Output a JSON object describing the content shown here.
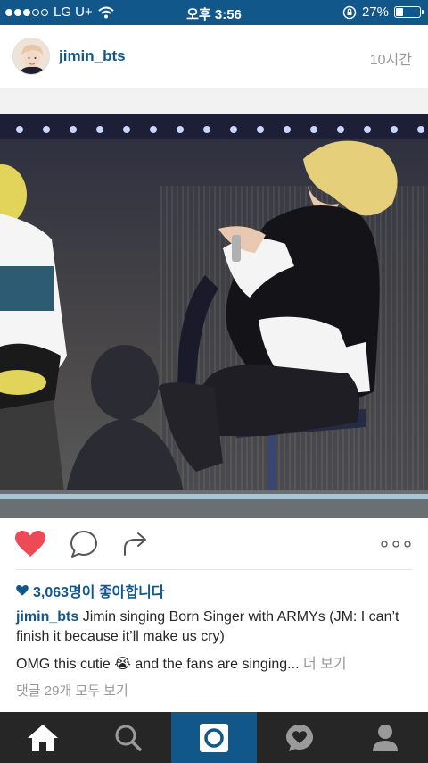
{
  "status_bar": {
    "carrier": "LG U+",
    "time": "오후 3:56",
    "battery_percent": "27%",
    "battery_level": 0.27,
    "signal_bars_filled": 3
  },
  "post": {
    "username": "jimin_bts",
    "time_ago": "10시간",
    "likes": "3,063명이 좋아합니다",
    "caption_user": "jimin_bts",
    "caption_text": "Jimin singing Born Singer with ARMYs (JM: I can’t finish it because it’ll make us cry)",
    "comment_text": "OMG this cutie 😭 and the fans are singing...",
    "more_label": "더 보기",
    "view_all_comments": "댓글 29개 모두 보기",
    "liked": true
  },
  "tabs": [
    {
      "icon": "home-icon",
      "active": false
    },
    {
      "icon": "search-icon",
      "active": false
    },
    {
      "icon": "camera-icon",
      "active": true
    },
    {
      "icon": "activity-heart-icon",
      "active": false
    },
    {
      "icon": "profile-icon",
      "active": false
    }
  ],
  "colors": {
    "brand_blue": "#12578a",
    "like_red": "#ed4956",
    "tab_bar_bg": "#262626"
  }
}
